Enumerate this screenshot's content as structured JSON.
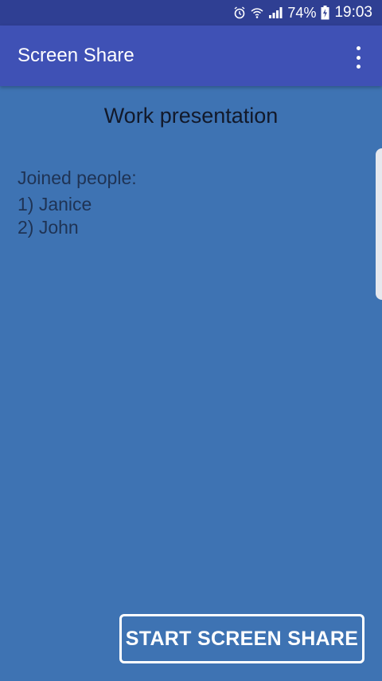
{
  "status_bar": {
    "icons": [
      "alarm-icon",
      "wifi-icon",
      "signal-icon"
    ],
    "battery_percent": "74%",
    "battery_icon": "battery-charging-icon",
    "time": "19:03"
  },
  "app_bar": {
    "title": "Screen Share",
    "menu_icon": "more-vert-icon"
  },
  "content": {
    "session_title": "Work presentation",
    "joined_label": "Joined people:",
    "people": [
      "1) Janice",
      "2) John"
    ]
  },
  "actions": {
    "start_label": "START SCREEN SHARE"
  },
  "colors": {
    "background": "#3e73b3",
    "app_bar": "#3f51b5",
    "status_bar": "#2f3f93"
  }
}
